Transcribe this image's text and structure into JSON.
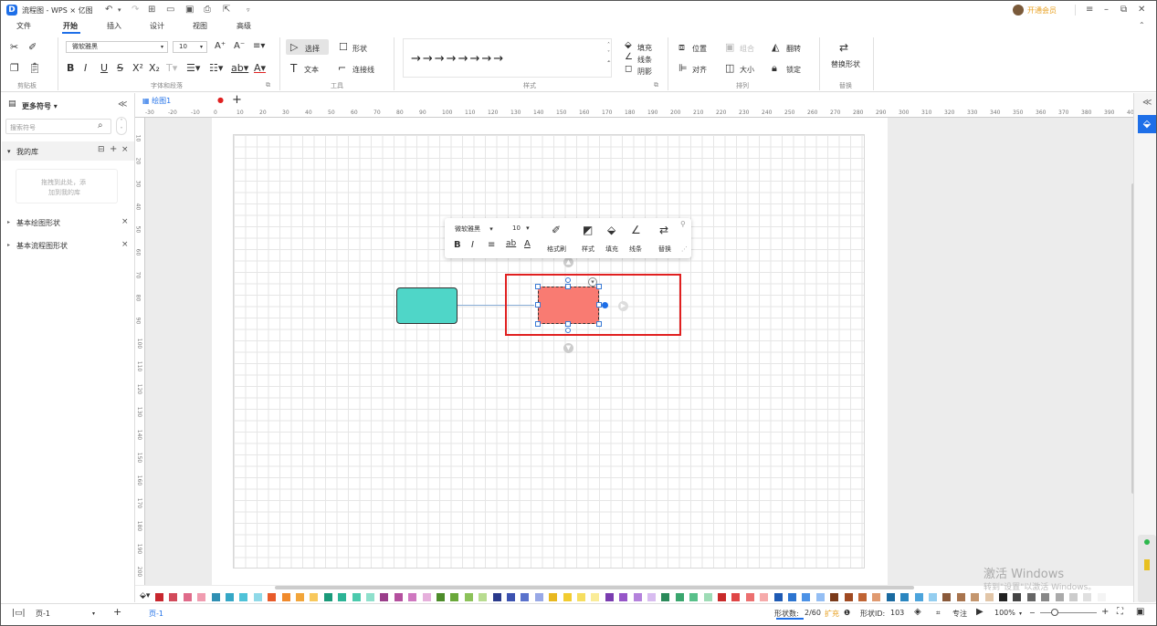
{
  "window": {
    "title": "流程图 - WPS × 亿图",
    "vip": "开通会员"
  },
  "menu": {
    "items": [
      "文件",
      "开始",
      "插入",
      "设计",
      "视图",
      "高级"
    ],
    "active": "开始"
  },
  "ribbon": {
    "clipboard_group": "剪贴板",
    "font_name": "微软雅黑",
    "font_size": "10",
    "font_group": "字体和段落",
    "select_label": "选择",
    "shape_label": "形状",
    "text_label": "文本",
    "connector_label": "连接线",
    "tools_group": "工具",
    "fill_label": "填充",
    "line_label": "线条",
    "shadow_label": "阴影",
    "style_group": "样式",
    "position_label": "位置",
    "group_label": "组合",
    "flip_label": "翻转",
    "align_label": "对齐",
    "size_label": "大小",
    "lock_label": "锁定",
    "arrange_group": "排列",
    "replace_shape_label": "替换形状",
    "replace_group": "替换"
  },
  "sidebar": {
    "title": "更多符号",
    "search_placeholder": "搜索符号",
    "my_library": "我的库",
    "drop_hint_1": "拖拽到此处，添",
    "drop_hint_2": "加到我的库",
    "libs": [
      "基本绘图形状",
      "基本流程图形状"
    ]
  },
  "tab": {
    "name": "绘图1"
  },
  "ruler": {
    "h": [
      "-30",
      "-20",
      "-10",
      "0",
      "10",
      "20",
      "30",
      "40",
      "50",
      "60",
      "70",
      "80",
      "90",
      "100",
      "110",
      "120",
      "130",
      "140",
      "150",
      "160",
      "170",
      "180",
      "190",
      "200",
      "210",
      "220",
      "230",
      "240",
      "250",
      "260",
      "270",
      "280",
      "290",
      "300",
      "310",
      "320",
      "330",
      "340",
      "350",
      "360",
      "370",
      "380",
      "390",
      "40"
    ],
    "v": [
      "10",
      "20",
      "30",
      "40",
      "50",
      "60",
      "70",
      "80",
      "90",
      "100",
      "110",
      "120",
      "130",
      "140",
      "150",
      "160",
      "170",
      "180",
      "190",
      "200"
    ]
  },
  "floating_toolbar": {
    "font": "微软雅黑",
    "size": "10",
    "format_painter": "格式刷",
    "style": "样式",
    "fill": "填充",
    "line": "线条",
    "replace": "替换"
  },
  "status": {
    "page_select": "页-1",
    "page_tab": "页-1",
    "shape_count_label": "形状数:",
    "shape_count": "2/60",
    "expand": "扩充",
    "shape_id_label": "形状ID:",
    "shape_id": "103",
    "focus": "专注",
    "zoom": "100%"
  },
  "watermark": {
    "line1": "激活 Windows",
    "line2": "转到\"设置\"以激活 Windows。"
  },
  "colors": {
    "accent": "#1e6fe8",
    "teal_shape": "#4fd6c8",
    "red_shape": "#f97b72",
    "selection": "#e02020"
  },
  "palette": [
    "#c8262e",
    "#d24a5a",
    "#e06b8a",
    "#f09cb0",
    "#2f8fb3",
    "#35a7c6",
    "#4fc2d8",
    "#8fd9e8",
    "#e85b2a",
    "#f08a2c",
    "#f2a53a",
    "#f8c85c",
    "#1a9a7a",
    "#2cb496",
    "#4bcaad",
    "#8fe0cc",
    "#9a3e8a",
    "#b4509e",
    "#cf78c0",
    "#e6b0dc",
    "#4d8c2a",
    "#6aa83a",
    "#8cc25a",
    "#b8dc90",
    "#2a3a8c",
    "#3c52b0",
    "#5a72cc",
    "#98a8e6",
    "#e8b820",
    "#f2cc30",
    "#f6de60",
    "#faec98",
    "#7a3cb0",
    "#9656c8",
    "#b482dc",
    "#d8bcf0",
    "#2a8a5a",
    "#3aa66e",
    "#58c08a",
    "#9edcb6",
    "#c82a2a",
    "#e04646",
    "#ec7070",
    "#f6aaaa",
    "#1e5ab4",
    "#2c74d0",
    "#4c92e6",
    "#94bef4",
    "#7a3a1a",
    "#a04a22",
    "#c06434",
    "#e09a70",
    "#1a6aa0",
    "#2a86c0",
    "#4ca4dc",
    "#94cef0",
    "#8a5a3a",
    "#a8744e",
    "#c4966e",
    "#e2c6a8",
    "#222222",
    "#444444",
    "#666666",
    "#888888",
    "#aaaaaa",
    "#cccccc",
    "#e0e0e0",
    "#f4f4f4"
  ]
}
